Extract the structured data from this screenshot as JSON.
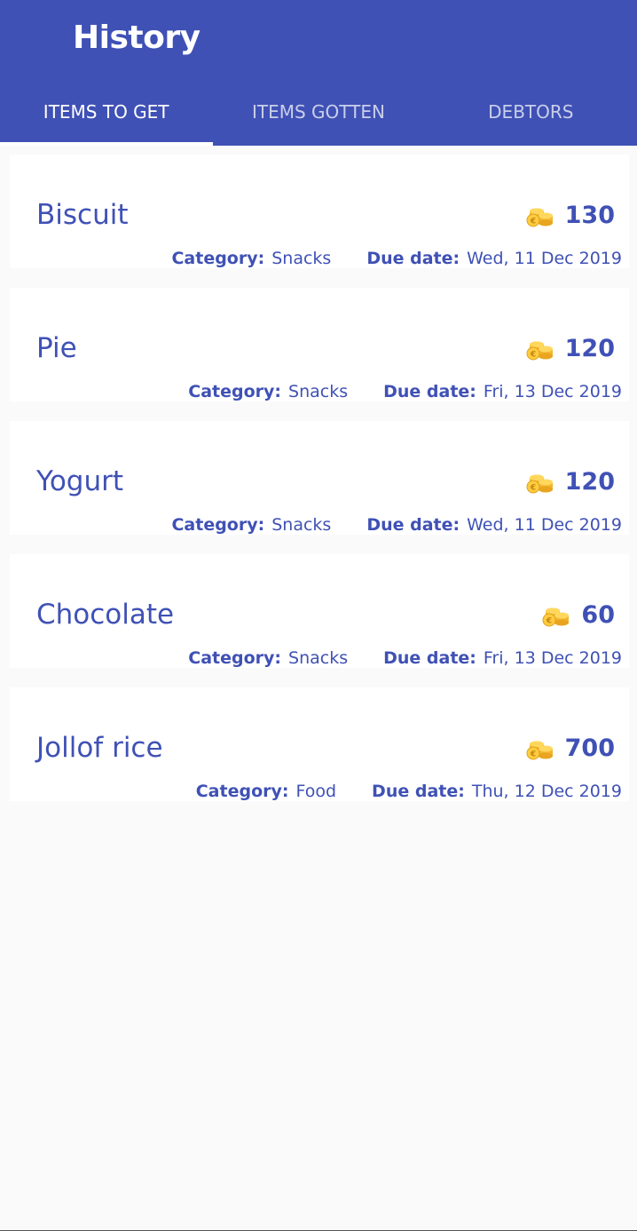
{
  "app": {
    "title": "History",
    "colors": {
      "primary": "#3f51b5",
      "background": "#fafafa"
    }
  },
  "tabs": [
    {
      "label": "ITEMS TO GET",
      "active": true
    },
    {
      "label": "ITEMS GOTTEN",
      "active": false
    },
    {
      "label": "DEBTORS",
      "active": false
    }
  ],
  "labels": {
    "category": "Category:",
    "due_date": "Due date:"
  },
  "items": [
    {
      "name": "Biscuit",
      "price": "130",
      "category": "Snacks",
      "due": "Wed, 11 Dec 2019",
      "icon": "coins-icon"
    },
    {
      "name": "Pie",
      "price": "120",
      "category": "Snacks",
      "due": "Fri, 13 Dec 2019",
      "icon": "coins-icon"
    },
    {
      "name": "Yogurt",
      "price": "120",
      "category": "Snacks",
      "due": "Wed, 11 Dec 2019",
      "icon": "coins-icon"
    },
    {
      "name": "Chocolate",
      "price": "60",
      "category": "Snacks",
      "due": "Fri, 13 Dec 2019",
      "icon": "coins-icon"
    },
    {
      "name": "Jollof rice",
      "price": "700",
      "category": "Food",
      "due": "Thu, 12 Dec 2019",
      "icon": "coins-icon"
    }
  ]
}
